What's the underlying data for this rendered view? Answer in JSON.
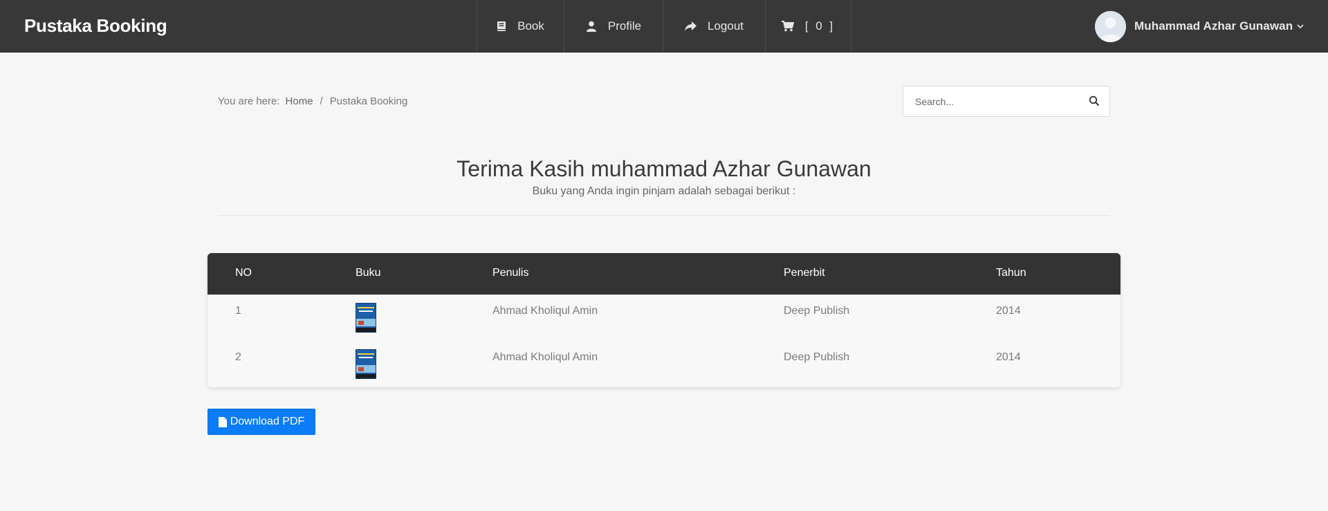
{
  "brand": "Pustaka Booking",
  "nav": {
    "book": {
      "label": "Book",
      "icon": "book-icon"
    },
    "profile": {
      "label": "Profile",
      "icon": "user-icon"
    },
    "logout": {
      "label": "Logout",
      "icon": "share-arrow-icon"
    },
    "cart": {
      "label": "[ 0 ]",
      "icon": "cart-icon"
    }
  },
  "user": {
    "name": "Muhammad Azhar Gunawan",
    "icon": "chevron-down-icon"
  },
  "breadcrumb": {
    "prefix": "You are here:",
    "home": "Home",
    "separator": "/",
    "current": "Pustaka Booking"
  },
  "search": {
    "placeholder": "Search...",
    "value": ""
  },
  "main": {
    "title": "Terima Kasih muhammad Azhar Gunawan",
    "subtitle": "Buku yang Anda ingin pinjam adalah sebagai berikut :"
  },
  "table": {
    "headers": [
      "NO",
      "Buku",
      "Penulis",
      "Penerbit",
      "Tahun"
    ],
    "rows": [
      {
        "no": "1",
        "penulis": "Ahmad Kholiqul Amin",
        "penerbit": "Deep Publish",
        "tahun": "2014"
      },
      {
        "no": "2",
        "penulis": "Ahmad Kholiqul Amin",
        "penerbit": "Deep Publish",
        "tahun": "2014"
      }
    ]
  },
  "download": {
    "label": "Download PDF",
    "icon": "file-icon"
  },
  "colors": {
    "navbar": "#383838",
    "table_header": "#333333",
    "accent": "#0b7cf5",
    "background": "#f6f6f6"
  }
}
